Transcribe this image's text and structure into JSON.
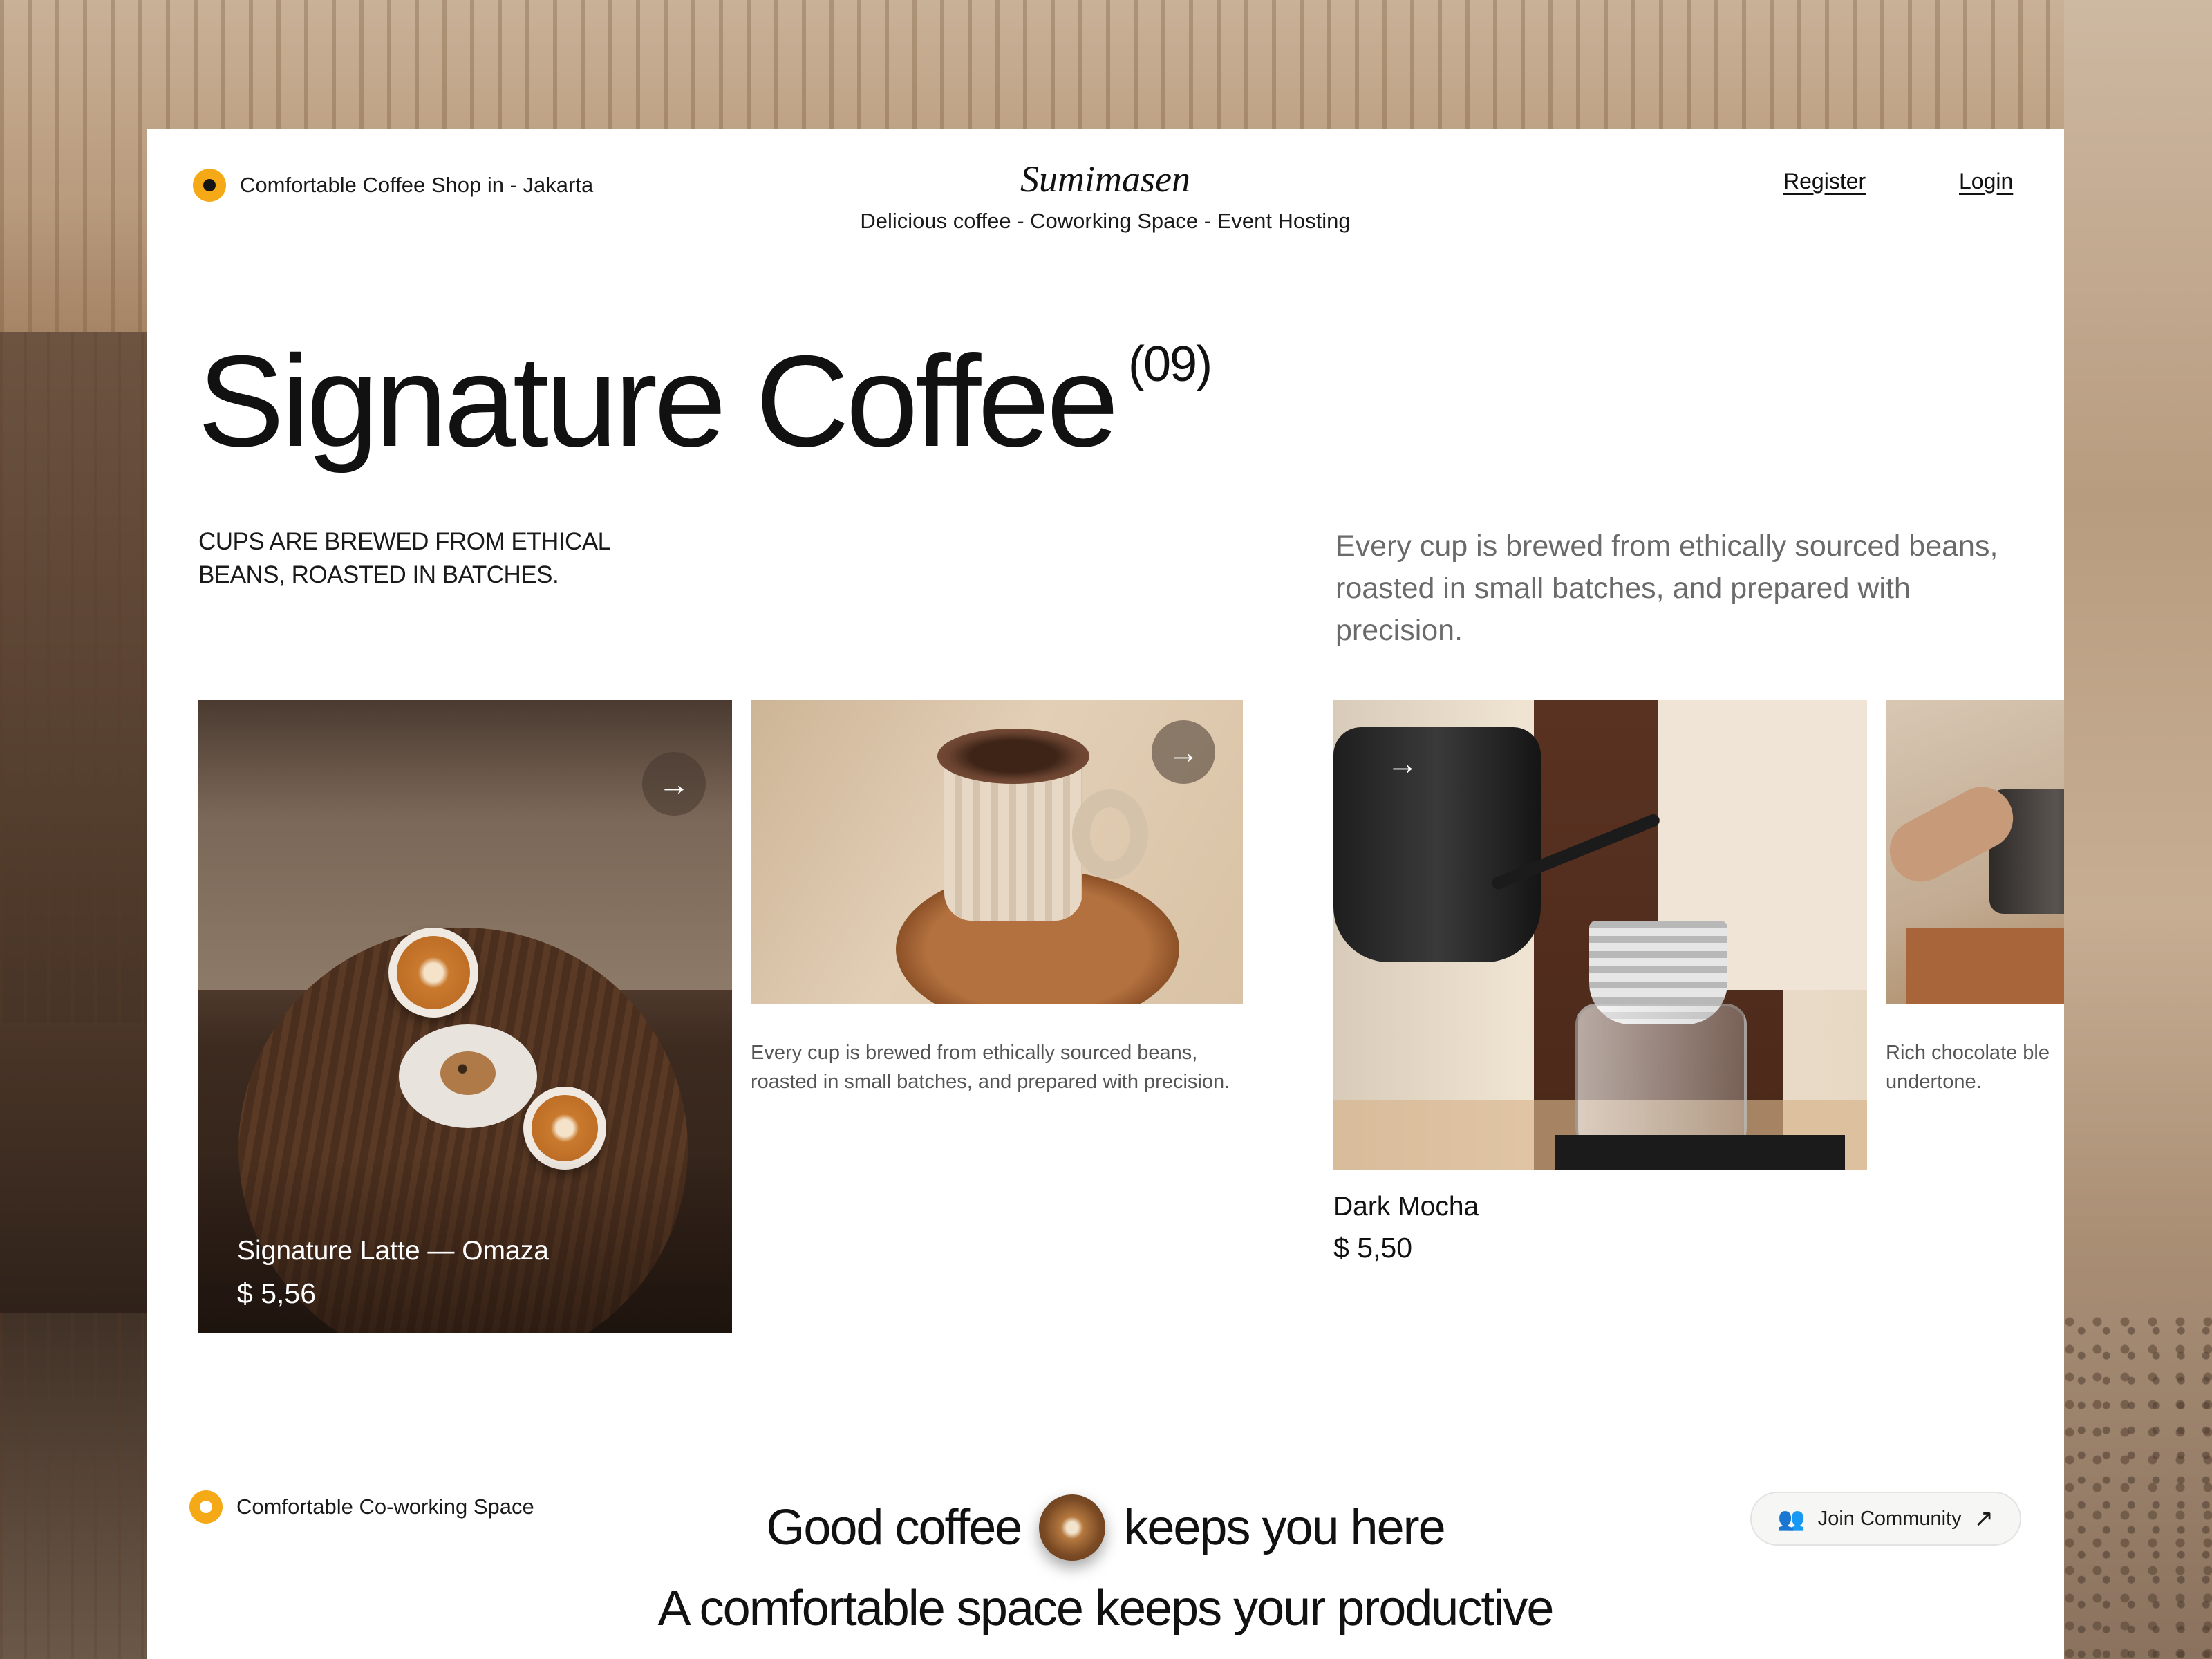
{
  "header": {
    "location_label": "Comfortable Coffee Shop in - Jakarta",
    "brand_name": "Sumimasen",
    "brand_tagline": "Delicious coffee - Coworking Space - Event Hosting",
    "register_label": "Register",
    "login_label": "Login"
  },
  "hero": {
    "title": "Signature Coffee",
    "count": "(09)",
    "caps_line1": "CUPS ARE BREWED FROM ETHICAL",
    "caps_line2": "BEANS, ROASTED IN BATCHES.",
    "lead": "Every cup is brewed from ethically sourced beans, roasted in small batches, and prepared with precision."
  },
  "products": [
    {
      "name": "Signature Latte — Omaza",
      "price": "$ 5,56",
      "image": "latte-table-photo"
    },
    {
      "description": "Every cup is brewed from ethically sourced beans, roasted in small batches, and prepared with precision.",
      "image": "chocolate-cup-photo"
    },
    {
      "name": "Dark Mocha",
      "price": "$ 5,50",
      "image": "pour-over-photo"
    },
    {
      "description": "Rich chocolate ble undertone.",
      "image": "iced-drink-photo"
    }
  ],
  "icons": {
    "arrow": "→",
    "people": "👥",
    "external": "↗"
  },
  "cowork": {
    "label": "Comfortable Co-working Space",
    "slogan_part1": "Good coffee",
    "slogan_part2": "keeps you here",
    "slogan_line2": "A comfortable space keeps your productive",
    "cta_label": "Join Community"
  },
  "colors": {
    "accent": "#f5a917",
    "text": "#111111",
    "muted": "#6a6a6a"
  }
}
